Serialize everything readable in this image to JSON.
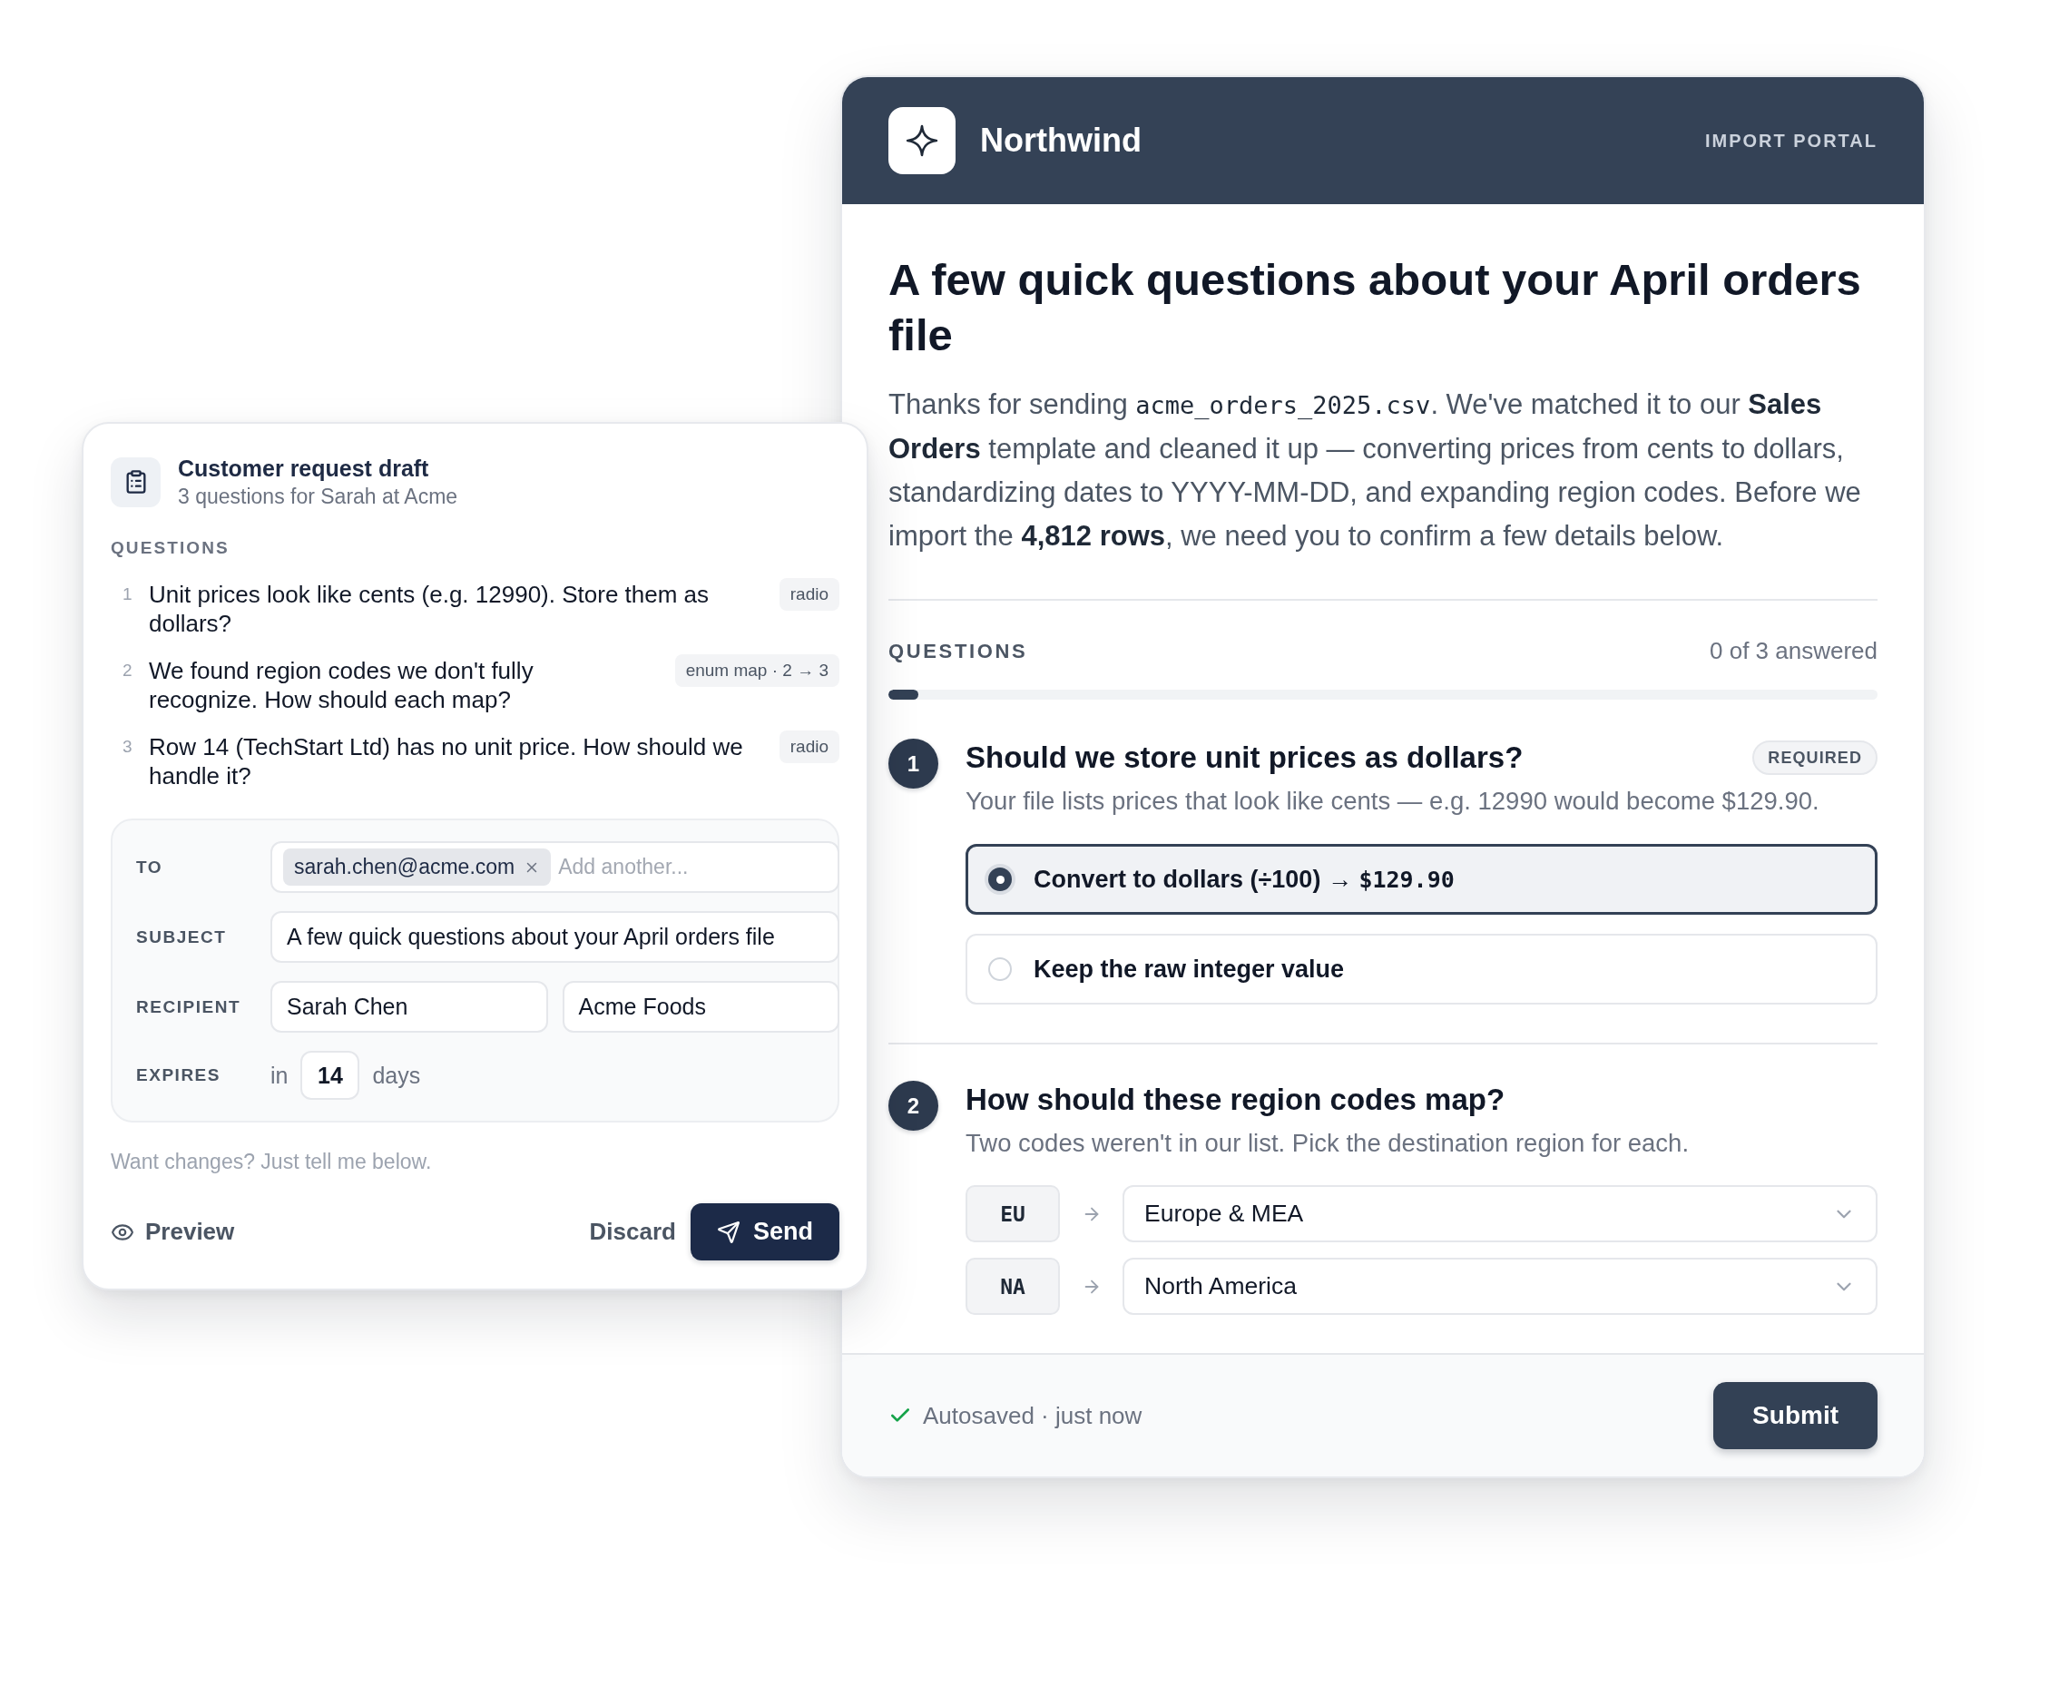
{
  "draft": {
    "title": "Customer request draft",
    "subtitle": "3 questions for Sarah at Acme",
    "section_label": "QUESTIONS",
    "questions": [
      {
        "number": "1",
        "text": "Unit prices look like cents (e.g. 12990). Store them as dollars?",
        "tag": "radio"
      },
      {
        "number": "2",
        "text": "We found region codes we don't fully recognize. How should each map?",
        "tag": "enum map · 2 → 3"
      },
      {
        "number": "3",
        "text": "Row 14 (TechStart Ltd) has no unit price. How should we handle it?",
        "tag": "radio"
      }
    ],
    "fields": [
      {
        "kind": "recipients",
        "label": "TO",
        "chips": [
          "sarah.chen@acme.com"
        ],
        "placeholder": "Add another..."
      },
      {
        "kind": "text",
        "label": "SUBJECT",
        "value": "A few quick questions about your April orders file"
      },
      {
        "kind": "pair",
        "label": "RECIPIENT",
        "values": [
          "Sarah Chen",
          "Acme Foods"
        ]
      },
      {
        "kind": "days",
        "label": "EXPIRES",
        "prefix": "in",
        "value": "14",
        "suffix": "days"
      }
    ],
    "note": "Want changes? Just tell me below.",
    "actions": {
      "preview": "Preview",
      "discard": "Discard",
      "send": "Send"
    }
  },
  "portal": {
    "brand": "Northwind",
    "portal_label": "IMPORT PORTAL",
    "title": "A few quick questions about your April orders file",
    "intro": [
      {
        "kind": "text",
        "text": "Thanks for sending "
      },
      {
        "kind": "code",
        "text": "acme_orders_2025.csv"
      },
      {
        "kind": "text",
        "text": ". We've matched it to our **Sales Orders** template and cleaned it up — converting prices from cents to dollars, standardizing dates to YYYY-MM-DD, and expanding region codes. Before we import the **4,812 rows**, we need you to confirm a few details below."
      }
    ],
    "section_label": "QUESTIONS",
    "answered": "0 of 3 answered",
    "progress": {
      "level": 0.03
    },
    "questions": [
      {
        "kind": "choice",
        "number": "1",
        "title": "Should we store unit prices as dollars?",
        "badge": "REQUIRED",
        "hint": "Your file lists prices that look like cents — e.g. 12990 would become $129.90.",
        "options": [
          {
            "label": "Convert to dollars (÷100) →",
            "code": "$129.90",
            "selected": true
          },
          {
            "label": "Keep the raw integer value",
            "selected": false
          }
        ]
      },
      {
        "kind": "mapping",
        "number": "2",
        "title": "How should these region codes map?",
        "hint": "Two codes weren't in our list. Pick the destination region for each.",
        "mappings": [
          {
            "code": "EU",
            "region": "Europe & MEA"
          },
          {
            "code": "NA",
            "region": "North America"
          }
        ]
      }
    ],
    "footer": {
      "status": "Autosaved · just now",
      "submit": "Submit"
    }
  }
}
